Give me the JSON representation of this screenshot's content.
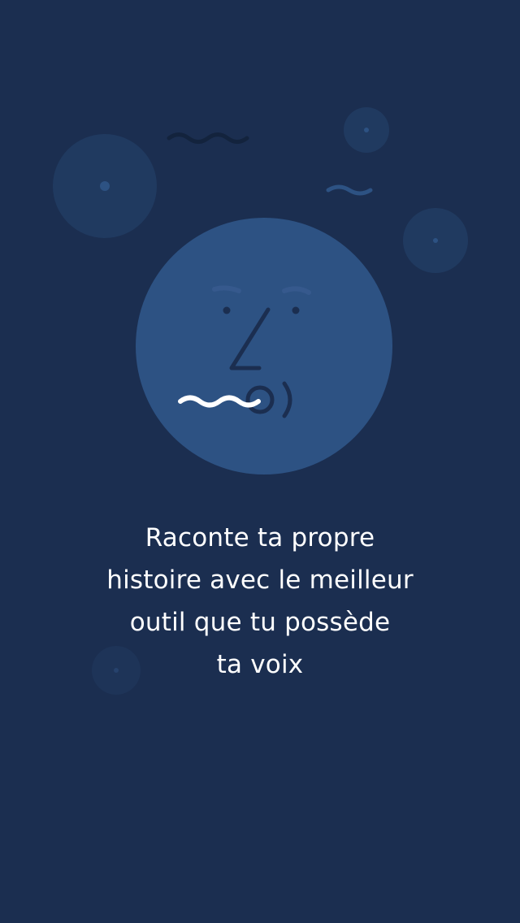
{
  "onboarding": {
    "headline_lines": [
      "Raconte ta propre",
      "histoire avec le meilleur",
      "outil que tu possède",
      "ta voix"
    ]
  },
  "colors": {
    "background": "#1b2e50",
    "face": "#2d5283",
    "face_features": "#1b2e50",
    "bubble": "#203a60",
    "mouth_wave": "#ffffff"
  },
  "icons": {
    "illustration": "speaking-face-icon"
  }
}
